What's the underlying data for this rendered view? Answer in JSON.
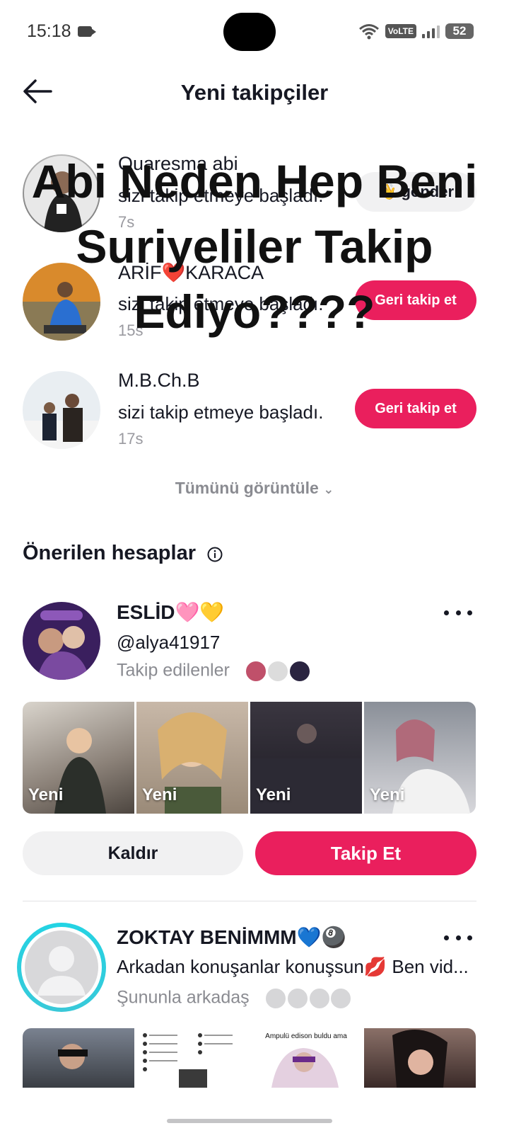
{
  "status_bar": {
    "time": "15:18",
    "network": "VoLTE",
    "battery": "52"
  },
  "header": {
    "title": "Yeni takipçiler",
    "back_icon": "arrow-left-icon"
  },
  "new_followers": [
    {
      "name": "Quaresma abi",
      "desc": "sizi takip etmeye başladı.",
      "time": "7s",
      "action": "👋 gönder"
    },
    {
      "name": "ARİF❤️KARACA",
      "desc": "sizi takip etmeye başladı.",
      "time": "15s",
      "action": "Geri takip et"
    },
    {
      "name": "M.B.Ch.B",
      "desc": "sizi takip etmeye başladı.",
      "time": "17s",
      "action": "Geri takip et"
    }
  ],
  "see_all": "Tümünü görüntüle",
  "overlay": "Abi Neden Hep Beni Suriyeliler Takip Ediyo????",
  "suggested": {
    "title": "Önerilen hesaplar",
    "accounts": [
      {
        "name": "ESLİD🩷💛",
        "handle": "@alya41917",
        "meta": "Takip edilenler",
        "thumb_label": "Yeni",
        "remove_label": "Kaldır",
        "follow_label": "Takip Et"
      },
      {
        "name": "ZOKTAY BENİMMM💙🎱",
        "bio": "Arkadan konuşanlar konuşsun💋 Ben vid...",
        "meta": "Şununla arkadaş"
      }
    ]
  },
  "thumb_caption": "Ampulü edison buldu ama",
  "colors": {
    "accent": "#ea1f5d",
    "text": "#161823",
    "muted": "#8a8b91",
    "light": "#f1f1f2"
  }
}
